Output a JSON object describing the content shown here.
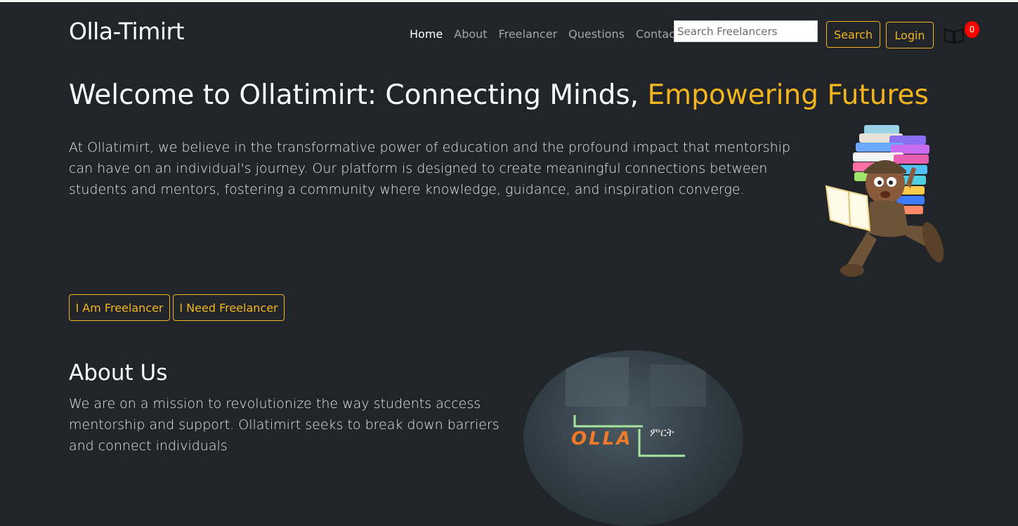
{
  "header": {
    "brand": "Olla-Timirt",
    "nav": [
      "Home",
      "About",
      "Freelancer",
      "Questions",
      "Contact"
    ],
    "search_placeholder": "Search Freelancers",
    "search_label": "Search",
    "login_label": "Login",
    "cart_count": "0"
  },
  "hero": {
    "title_main": "Welcome to Ollatimirt: Connecting Minds, ",
    "title_accent": "Empowering Futures",
    "intro": "At Ollatimirt, we believe in the transformative power of education and the profound impact that mentorship can have on an individual's journey. Our platform is designed to create meaningful connections between students and mentors, fostering a community where knowledge, guidance, and inspiration converge.",
    "btn_freelancer": "I Am Freelancer",
    "btn_need": "I Need Freelancer"
  },
  "about": {
    "title": "About Us",
    "text": "We are on a mission to revolutionize the way students access mentorship and support. Ollatimirt seeks to break down barriers and connect individuals",
    "logo_text": "OLLA",
    "logo_suffix": "ምርት"
  },
  "colors": {
    "accent": "#f3b51d",
    "background": "#212529",
    "badge": "#ff0000"
  }
}
